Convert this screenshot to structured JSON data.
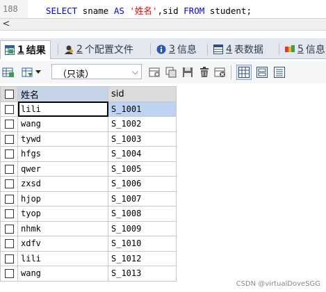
{
  "editor": {
    "line_number": "188",
    "sql": [
      {
        "t": "SELECT",
        "c": "kw"
      },
      {
        "t": " sname ",
        "c": "plain"
      },
      {
        "t": "AS",
        "c": "kw"
      },
      {
        "t": " ",
        "c": "plain"
      },
      {
        "t": "'姓名'",
        "c": "str"
      },
      {
        "t": ",sid ",
        "c": "plain"
      },
      {
        "t": "FROM",
        "c": "kw"
      },
      {
        "t": " student;",
        "c": "plain"
      }
    ]
  },
  "scrollbar": {
    "left_arrow": "<"
  },
  "tabs": [
    {
      "num": "1",
      "label": "结果",
      "icon": "grid-result-icon",
      "active": true
    },
    {
      "num": "2",
      "label": "个配置文件",
      "icon": "profile-icon",
      "active": false
    },
    {
      "num": "3",
      "label": "信息",
      "icon": "info-icon",
      "active": false
    },
    {
      "num": "4",
      "label": "表数据",
      "icon": "table-data-icon",
      "active": false
    },
    {
      "num": "5",
      "label": "信息",
      "icon": "info-colored-icon",
      "active": false
    }
  ],
  "toolbar": {
    "readonly_label": "（只读）",
    "dropdown_arrow": "⌵"
  },
  "grid": {
    "columns": [
      "姓名",
      "sid"
    ],
    "rows": [
      [
        "lili",
        "S_1001"
      ],
      [
        "wang",
        "S_1002"
      ],
      [
        "tywd",
        "S_1003"
      ],
      [
        "hfgs",
        "S_1004"
      ],
      [
        "qwer",
        "S_1005"
      ],
      [
        "zxsd",
        "S_1006"
      ],
      [
        "hjop",
        "S_1007"
      ],
      [
        "tyop",
        "S_1008"
      ],
      [
        "nhmk",
        "S_1009"
      ],
      [
        "xdfv",
        "S_1010"
      ],
      [
        "lili",
        "S_1012"
      ],
      [
        "wang",
        "S_1013"
      ]
    ],
    "selected_row": 0
  },
  "watermark": "CSDN @virtualDoveSGG",
  "colors": {
    "keyword": "#0000ff",
    "string": "#ff0000",
    "selection": "#bcd3f2"
  }
}
